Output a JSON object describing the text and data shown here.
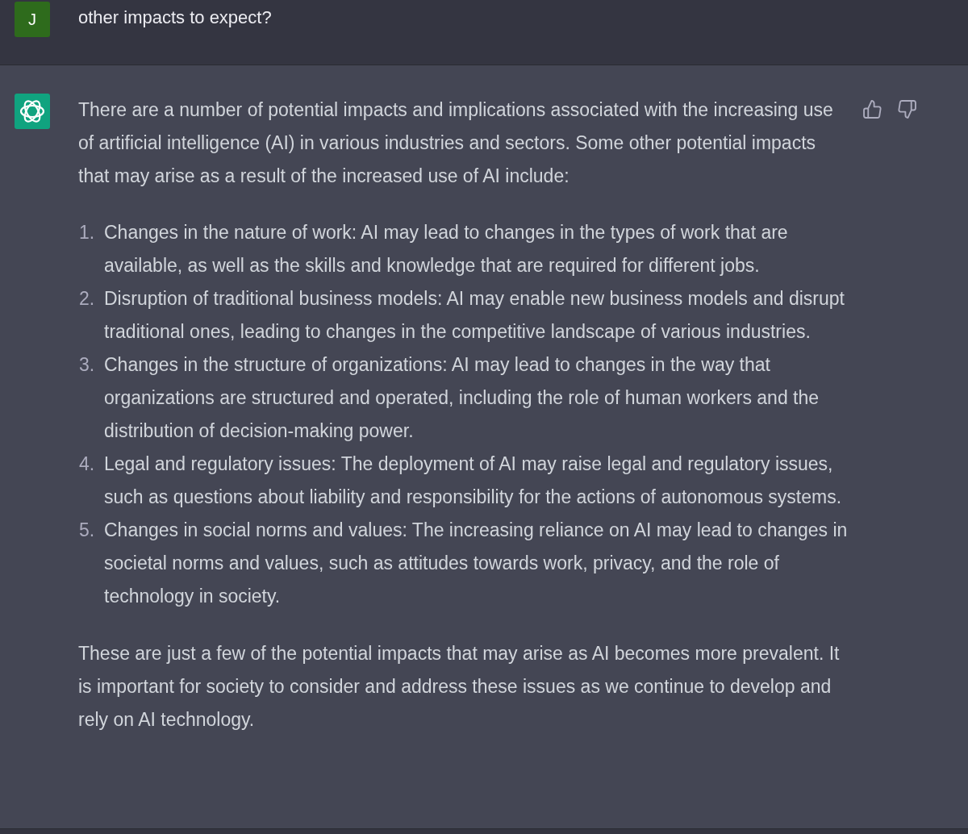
{
  "user_message": {
    "avatar_letter": "J",
    "text": "other impacts to expect?"
  },
  "assistant_message": {
    "intro": "There are a number of potential impacts and implications associated with the increasing use of artificial intelligence (AI) in various industries and sectors. Some other potential impacts that may arise as a result of the increased use of AI include:",
    "list": [
      {
        "number": "1.",
        "text": "Changes in the nature of work: AI may lead to changes in the types of work that are available, as well as the skills and knowledge that are required for different jobs."
      },
      {
        "number": "2.",
        "text": "Disruption of traditional business models: AI may enable new business models and disrupt traditional ones, leading to changes in the competitive landscape of various industries."
      },
      {
        "number": "3.",
        "text": "Changes in the structure of organizations: AI may lead to changes in the way that organizations are structured and operated, including the role of human workers and the distribution of decision-making power."
      },
      {
        "number": "4.",
        "text": "Legal and regulatory issues: The deployment of AI may raise legal and regulatory issues, such as questions about liability and responsibility for the actions of autonomous systems."
      },
      {
        "number": "5.",
        "text": "Changes in social norms and values: The increasing reliance on AI may lead to changes in societal norms and values, such as attitudes towards work, privacy, and the role of technology in society."
      }
    ],
    "outro": "These are just a few of the potential impacts that may arise as AI becomes more prevalent. It is important for society to consider and address these issues as we continue to develop and rely on AI technology."
  }
}
